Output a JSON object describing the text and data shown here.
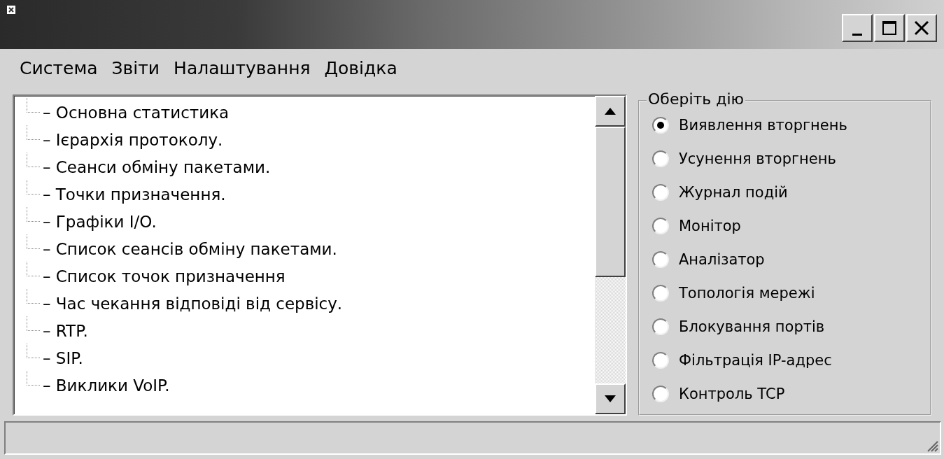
{
  "menu": [
    "Система",
    "Звіти",
    "Налаштування",
    "Довідка"
  ],
  "tree": {
    "items": [
      {
        "label": "– Основна статистика"
      },
      {
        "label": "– Ієрархія протоколу."
      },
      {
        "label": "– Сеанси обміну пакетами."
      },
      {
        "label": "– Точки призначення."
      },
      {
        "label": "– Графіки I/O."
      },
      {
        "label": "– Список сеансів обміну пакетами."
      },
      {
        "label": "– Список точок призначення"
      },
      {
        "label": "– Час чекання відповіді від сервісу."
      },
      {
        "label": "– RTP."
      },
      {
        "label": "– SIP."
      },
      {
        "label": "– Виклики VoIP."
      }
    ]
  },
  "actions": {
    "title": "Оберіть дію",
    "options": [
      {
        "label": "Виявлення вторгнень",
        "selected": true
      },
      {
        "label": "Усунення вторгнень",
        "selected": false
      },
      {
        "label": "Журнал подій",
        "selected": false
      },
      {
        "label": "Монітор",
        "selected": false
      },
      {
        "label": "Аналізатор",
        "selected": false
      },
      {
        "label": "Топологія мережі",
        "selected": false
      },
      {
        "label": "Блокування портів",
        "selected": false
      },
      {
        "label": "Фільтрація IP-адрес",
        "selected": false
      },
      {
        "label": "Контроль TCP",
        "selected": false
      }
    ]
  }
}
